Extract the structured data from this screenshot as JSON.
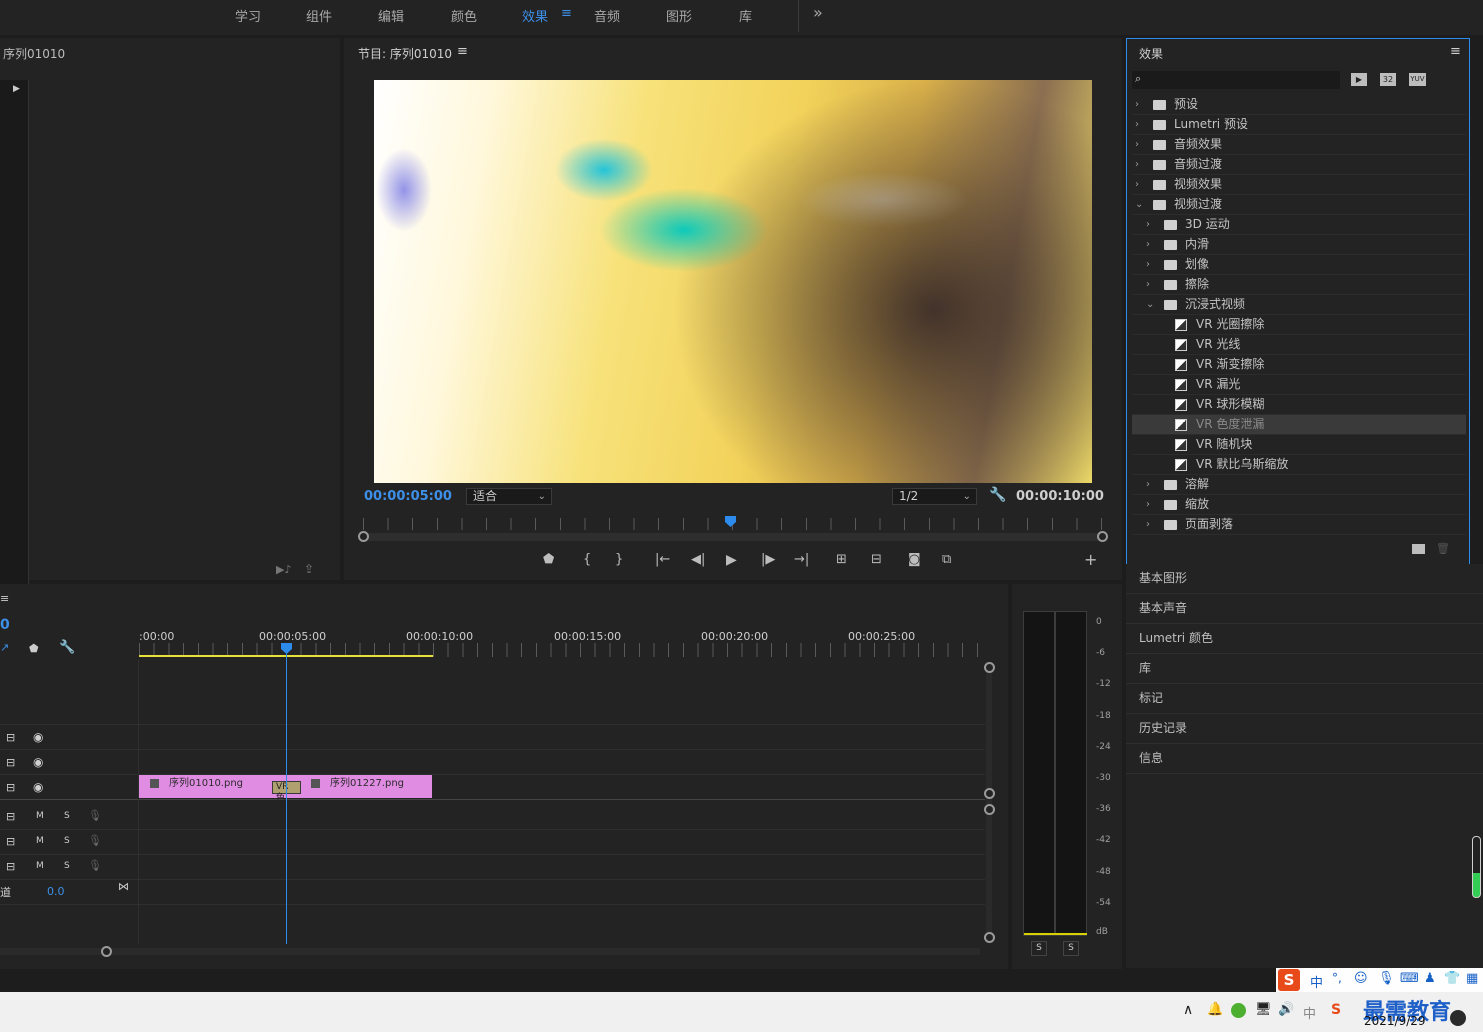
{
  "workspaces": [
    "学习",
    "组件",
    "编辑",
    "颜色",
    "效果",
    "音频",
    "图形",
    "库"
  ],
  "active_workspace_menu": "≡",
  "more": "»",
  "source": {
    "title": "序列01010"
  },
  "program": {
    "title": "节目: 序列01010",
    "menu": "≡",
    "timecode_current": "00:00:05:00",
    "fit": "适合",
    "resolution": "1/2",
    "timecode_duration": "00:00:10:00"
  },
  "effects": {
    "title": "效果",
    "menu": "≡",
    "filter_icons": [
      "32",
      "YUV"
    ],
    "tree": [
      {
        "label": "预设",
        "level": 0,
        "type": "folder-star",
        "expanded": false
      },
      {
        "label": "Lumetri 预设",
        "level": 0,
        "type": "folder-star",
        "expanded": false
      },
      {
        "label": "音频效果",
        "level": 0,
        "type": "folder",
        "expanded": false
      },
      {
        "label": "音频过渡",
        "level": 0,
        "type": "folder",
        "expanded": false
      },
      {
        "label": "视频效果",
        "level": 0,
        "type": "folder",
        "expanded": false
      },
      {
        "label": "视频过渡",
        "level": 0,
        "type": "folder",
        "expanded": true
      },
      {
        "label": "3D 运动",
        "level": 1,
        "type": "folder",
        "expanded": false
      },
      {
        "label": "内滑",
        "level": 1,
        "type": "folder",
        "expanded": false
      },
      {
        "label": "划像",
        "level": 1,
        "type": "folder",
        "expanded": false
      },
      {
        "label": "擦除",
        "level": 1,
        "type": "folder",
        "expanded": false
      },
      {
        "label": "沉浸式视频",
        "level": 1,
        "type": "folder",
        "expanded": true
      },
      {
        "label": "VR 光圈擦除",
        "level": 2,
        "type": "fx"
      },
      {
        "label": "VR 光线",
        "level": 2,
        "type": "fx"
      },
      {
        "label": "VR 渐变擦除",
        "level": 2,
        "type": "fx"
      },
      {
        "label": "VR 漏光",
        "level": 2,
        "type": "fx"
      },
      {
        "label": "VR 球形模糊",
        "level": 2,
        "type": "fx"
      },
      {
        "label": "VR 色度泄漏",
        "level": 2,
        "type": "fx",
        "selected": true
      },
      {
        "label": "VR 随机块",
        "level": 2,
        "type": "fx"
      },
      {
        "label": "VR 默比乌斯缩放",
        "level": 2,
        "type": "fx"
      },
      {
        "label": "溶解",
        "level": 1,
        "type": "folder",
        "expanded": false
      },
      {
        "label": "缩放",
        "level": 1,
        "type": "folder",
        "expanded": false
      },
      {
        "label": "页面剥落",
        "level": 1,
        "type": "folder",
        "expanded": false
      }
    ]
  },
  "side_panels": [
    "基本图形",
    "基本声音",
    "Lumetri 颜色",
    "库",
    "标记",
    "历史记录",
    "信息"
  ],
  "timeline": {
    "playhead_tc": "0",
    "ticks": [
      ":00:00",
      "00:00:05:00",
      "00:00:10:00",
      "00:00:15:00",
      "00:00:20:00",
      "00:00:25:00"
    ],
    "clips": [
      {
        "name": "序列01010.png"
      },
      {
        "name": "序列01227.png"
      }
    ],
    "transition": "VR 色",
    "audio_track_labels": [
      "M",
      "S"
    ],
    "master_label": "道",
    "master_value": "0.0"
  },
  "meter": {
    "db_labels": [
      "0",
      "-6",
      "-12",
      "-18",
      "-24",
      "-30",
      "-36",
      "-42",
      "-48",
      "-54",
      "dB"
    ],
    "solo": [
      "S",
      "S"
    ]
  },
  "ime": {
    "lang": "中"
  },
  "taskbar": {
    "date": "2021/9/29",
    "watermark": "最需教育",
    "ime_lang": "中"
  },
  "colors": {
    "accent": "#2d8ceb",
    "clip": "#e18ce3",
    "workarea": "#e8e03a"
  }
}
